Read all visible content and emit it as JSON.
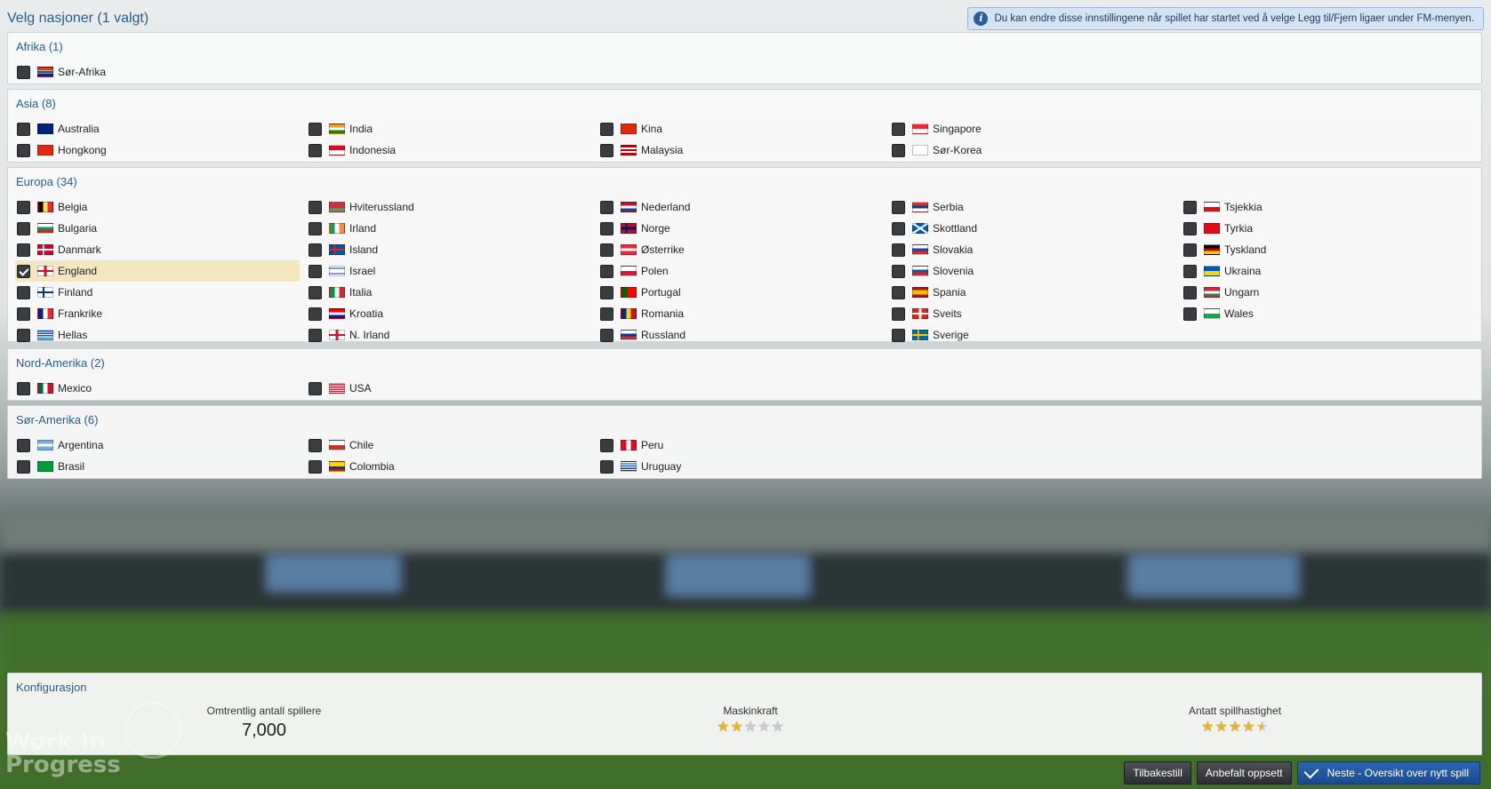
{
  "header": {
    "title": "Velg nasjoner (1 valgt)",
    "info_text": "Du kan endre disse innstillingene når spillet har startet ved å velge Legg til/Fjern ligaer under FM-menyen."
  },
  "regions": [
    {
      "title": "Afrika (1)",
      "items": [
        {
          "label": "Sør-Afrika",
          "flag": "flag-south-africa"
        }
      ]
    },
    {
      "title": "Asia (8)",
      "items": [
        {
          "label": "Australia",
          "flag": "flag-australia"
        },
        {
          "label": "Hongkong",
          "flag": "flag-hongkong"
        },
        {
          "label": "India",
          "flag": "flag-india"
        },
        {
          "label": "Indonesia",
          "flag": "flag-indonesia"
        },
        {
          "label": "Kina",
          "flag": "flag-china"
        },
        {
          "label": "Malaysia",
          "flag": "flag-malaysia"
        },
        {
          "label": "Singapore",
          "flag": "flag-singapore"
        },
        {
          "label": "Sør-Korea",
          "flag": "flag-south-korea"
        }
      ]
    },
    {
      "title": "Europa (34)",
      "items": [
        {
          "label": "Belgia",
          "flag": "flag-belgium"
        },
        {
          "label": "Bulgaria",
          "flag": "flag-bulgaria"
        },
        {
          "label": "Danmark",
          "flag": "flag-denmark"
        },
        {
          "label": "England",
          "flag": "flag-england",
          "checked": true
        },
        {
          "label": "Finland",
          "flag": "flag-finland"
        },
        {
          "label": "Frankrike",
          "flag": "flag-france"
        },
        {
          "label": "Hellas",
          "flag": "flag-greece"
        },
        {
          "label": "Hviterussland",
          "flag": "flag-belarus"
        },
        {
          "label": "Irland",
          "flag": "flag-ireland"
        },
        {
          "label": "Island",
          "flag": "flag-iceland"
        },
        {
          "label": "Israel",
          "flag": "flag-israel"
        },
        {
          "label": "Italia",
          "flag": "flag-italy"
        },
        {
          "label": "Kroatia",
          "flag": "flag-croatia"
        },
        {
          "label": "N. Irland",
          "flag": "flag-northern-ireland"
        },
        {
          "label": "Nederland",
          "flag": "flag-netherlands"
        },
        {
          "label": "Norge",
          "flag": "flag-norway"
        },
        {
          "label": "Østerrike",
          "flag": "flag-austria"
        },
        {
          "label": "Polen",
          "flag": "flag-poland"
        },
        {
          "label": "Portugal",
          "flag": "flag-portugal"
        },
        {
          "label": "Romania",
          "flag": "flag-romania"
        },
        {
          "label": "Russland",
          "flag": "flag-russia"
        },
        {
          "label": "Serbia",
          "flag": "flag-serbia"
        },
        {
          "label": "Skottland",
          "flag": "flag-scotland"
        },
        {
          "label": "Slovakia",
          "flag": "flag-slovakia"
        },
        {
          "label": "Slovenia",
          "flag": "flag-slovenia"
        },
        {
          "label": "Spania",
          "flag": "flag-spain"
        },
        {
          "label": "Sveits",
          "flag": "flag-switzerland"
        },
        {
          "label": "Sverige",
          "flag": "flag-sweden"
        },
        {
          "label": "Tsjekkia",
          "flag": "flag-czechia"
        },
        {
          "label": "Tyrkia",
          "flag": "flag-turkey"
        },
        {
          "label": "Tyskland",
          "flag": "flag-germany"
        },
        {
          "label": "Ukraina",
          "flag": "flag-ukraine"
        },
        {
          "label": "Ungarn",
          "flag": "flag-hungary"
        },
        {
          "label": "Wales",
          "flag": "flag-wales"
        }
      ]
    },
    {
      "title": "Nord-Amerika (2)",
      "items": [
        {
          "label": "Mexico",
          "flag": "flag-mexico"
        },
        {
          "label": "USA",
          "flag": "flag-usa"
        }
      ]
    },
    {
      "title": "Sør-Amerika (6)",
      "items": [
        {
          "label": "Argentina",
          "flag": "flag-argentina"
        },
        {
          "label": "Brasil",
          "flag": "flag-brazil"
        },
        {
          "label": "Chile",
          "flag": "flag-chile"
        },
        {
          "label": "Colombia",
          "flag": "flag-colombia"
        },
        {
          "label": "Peru",
          "flag": "flag-peru"
        },
        {
          "label": "Uruguay",
          "flag": "flag-uruguay"
        }
      ]
    }
  ],
  "config": {
    "title": "Konfigurasjon",
    "players_label": "Omtrentlig antall spillere",
    "players_value": "7,000",
    "machine_label": "Maskinkraft",
    "machine_stars": 2,
    "speed_label": "Antatt spillhastighet",
    "speed_stars": 4.5
  },
  "buttons": {
    "reset": "Tilbakestill",
    "recommended": "Anbefalt oppsett",
    "next": "Neste - Oversikt over nytt spill"
  },
  "watermark": {
    "line1": "Work In",
    "line2": "Progress"
  },
  "colors": {
    "accent": "#2a5d8c",
    "selected_row": "#f3e6c0",
    "primary_button": "#1f5aa6"
  }
}
